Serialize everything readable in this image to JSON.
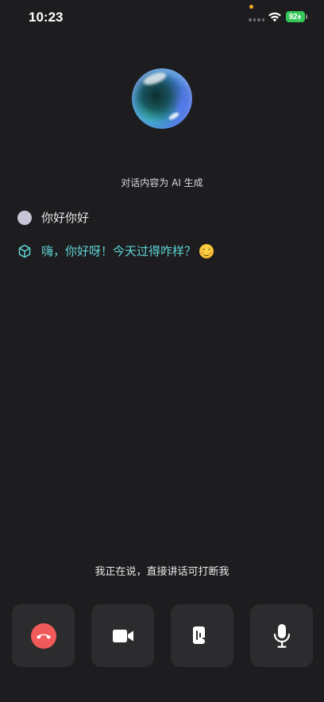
{
  "status_bar": {
    "time": "10:23",
    "battery_level": "92",
    "battery_color": "#34c759",
    "icons": [
      "wifi-icon",
      "battery-charging-icon"
    ]
  },
  "notice": "对话内容为 AI 生成",
  "messages": [
    {
      "role": "user",
      "text": "你好你好"
    },
    {
      "role": "assistant",
      "text": "嗨，你好呀！今天过得咋样？",
      "emoji": "smiling-face-icon"
    }
  ],
  "hint": "我正在说，直接讲话可打断我",
  "controls": [
    {
      "name": "hang-up-button",
      "icon": "phone-hangup-icon"
    },
    {
      "name": "video-button",
      "icon": "video-camera-icon"
    },
    {
      "name": "subtitle-button",
      "icon": "voice-to-text-icon"
    },
    {
      "name": "microphone-button",
      "icon": "microphone-icon"
    }
  ],
  "colors": {
    "background": "#1d1d1f",
    "assistant_text": "#5fd3d6",
    "hangup": "#f05a5a",
    "button_bg": "#2c2c2e"
  }
}
